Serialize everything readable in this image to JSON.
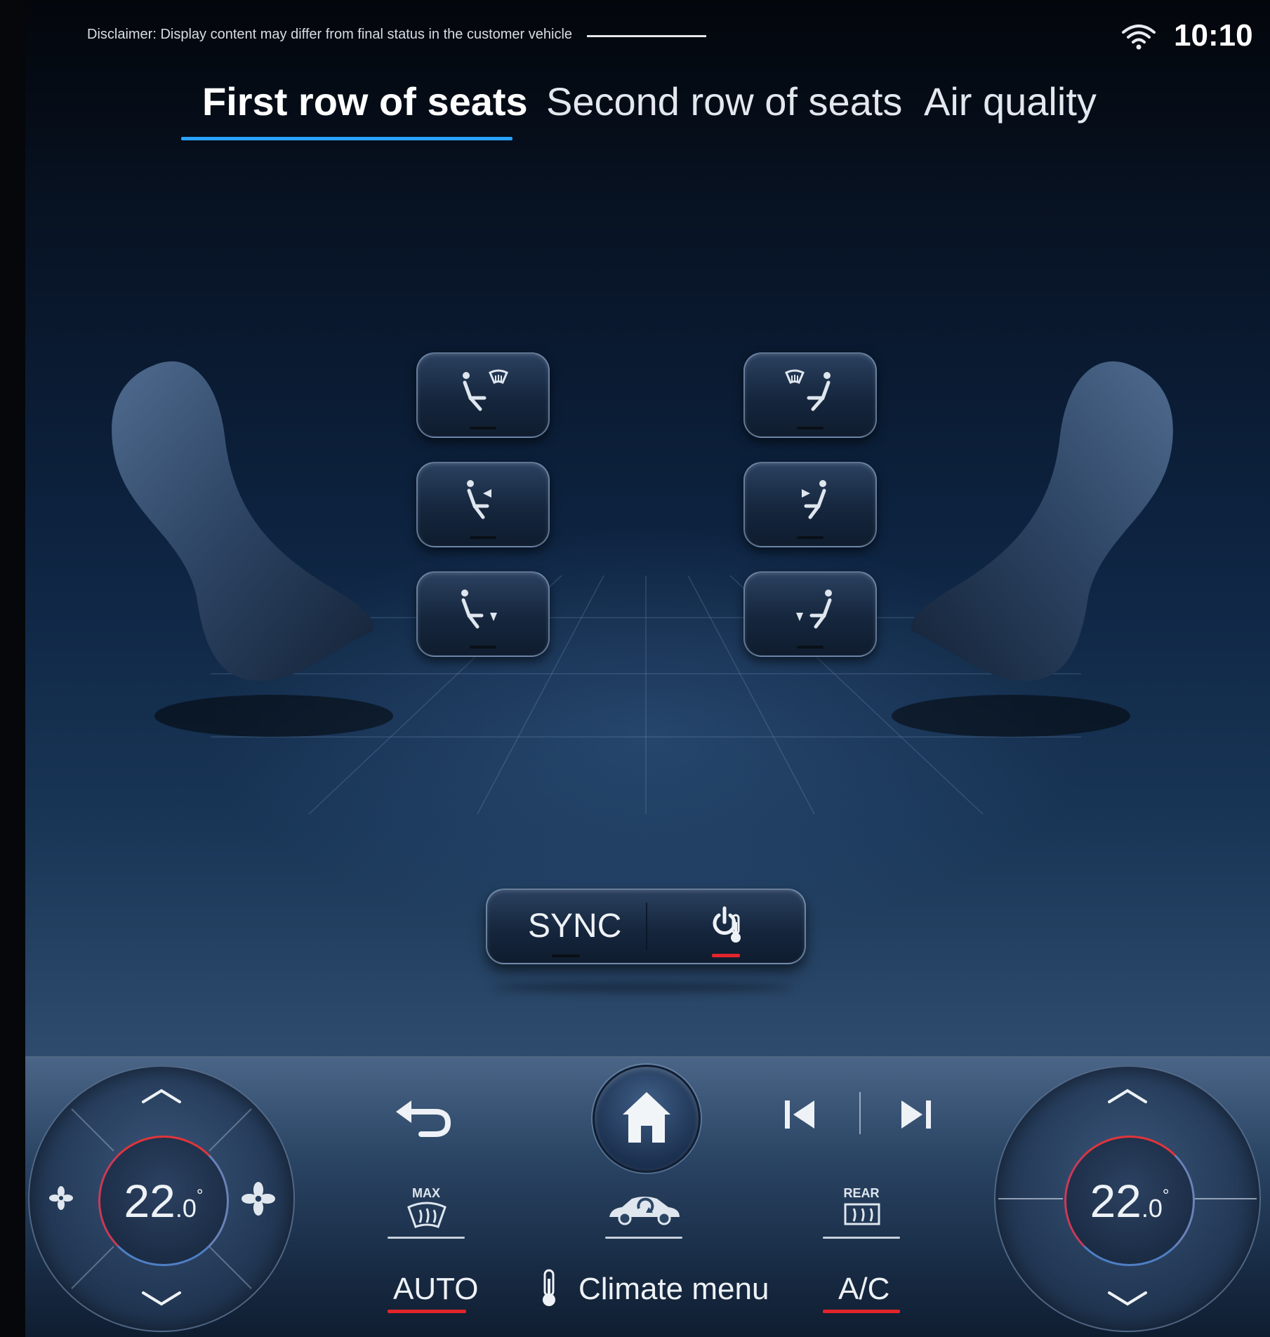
{
  "status": {
    "disclaimer": "Disclaimer: Display content may differ from final status in the customer vehicle",
    "time": "10:10",
    "icons": [
      "wifi-icon"
    ]
  },
  "tabs": [
    {
      "label": "First row of seats",
      "active": true
    },
    {
      "label": "Second row of seats",
      "active": false
    },
    {
      "label": "Air quality",
      "active": false
    }
  ],
  "seat_controls": {
    "left": [
      "seat-vent-windshield-icon",
      "seat-vent-upper-icon",
      "seat-vent-lower-icon"
    ],
    "right": [
      "seat-vent-windshield-icon",
      "seat-vent-upper-icon",
      "seat-vent-lower-icon"
    ]
  },
  "center_panel": {
    "sync_label": "SYNC",
    "sync_active": false,
    "heater_active": true
  },
  "dock": {
    "left_temp": {
      "whole": "22",
      "decimal": ".0",
      "unit": "°"
    },
    "right_temp": {
      "whole": "22",
      "decimal": ".0",
      "unit": "°"
    },
    "max_defrost_label": "MAX",
    "rear_defrost_label": "REAR",
    "auto_label": "AUTO",
    "climate_menu_label": "Climate menu",
    "ac_label": "A/C"
  },
  "colors": {
    "accent_blue": "#2aa3ff",
    "active_red": "#e3242b"
  }
}
